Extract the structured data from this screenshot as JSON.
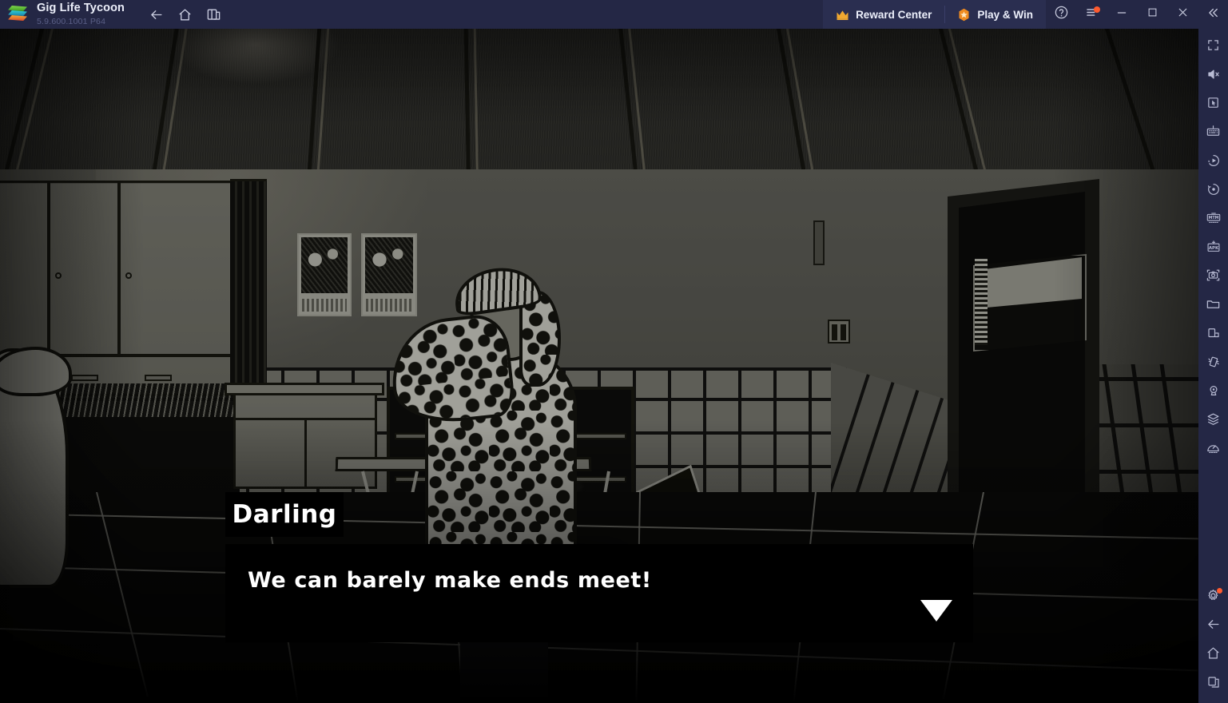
{
  "titlebar": {
    "logo_icon": "bluestacks-logo",
    "app_title": "Gig Life Tycoon",
    "app_version": "5.9.600.1001 P64",
    "nav": [
      {
        "name": "back",
        "icon": "arrow-left-icon"
      },
      {
        "name": "home",
        "icon": "home-icon"
      },
      {
        "name": "multi-instance",
        "icon": "windows-stack-icon"
      }
    ],
    "promos": [
      {
        "name": "reward-center",
        "label": "Reward Center",
        "icon": "crown-icon",
        "icon_color": "#f0a830"
      },
      {
        "name": "play-and-win",
        "label": "Play & Win",
        "icon": "star-badge-icon",
        "icon_color": "#f08c20"
      }
    ],
    "controls": [
      {
        "name": "help",
        "icon": "question-circle-icon",
        "badge": false
      },
      {
        "name": "menu",
        "icon": "hamburger-menu-icon",
        "badge": true
      },
      {
        "name": "minimize",
        "icon": "minimize-icon",
        "badge": false
      },
      {
        "name": "maximize",
        "icon": "maximize-icon",
        "badge": false
      },
      {
        "name": "close",
        "icon": "close-icon",
        "badge": false
      },
      {
        "name": "collapse",
        "icon": "double-chevron-left-icon",
        "badge": false
      }
    ],
    "bar_color": "#242745",
    "accent_color": "#ff5a2e"
  },
  "sidebar": {
    "top_items": [
      {
        "name": "fullscreen",
        "icon": "fullscreen-icon"
      },
      {
        "name": "mute",
        "icon": "speaker-mute-icon"
      },
      {
        "name": "game-controls",
        "icon": "cursor-in-box-icon"
      },
      {
        "name": "keyboard-controls",
        "icon": "keyboard-icon"
      },
      {
        "name": "macro-recorder",
        "icon": "play-circle-icon"
      },
      {
        "name": "script-record",
        "icon": "record-dot-icon"
      },
      {
        "name": "multi-instance-sync",
        "icon": "mtm-sync-icon"
      },
      {
        "name": "install-apk",
        "icon": "apk-plus-icon"
      },
      {
        "name": "screenshot",
        "icon": "camera-icon"
      },
      {
        "name": "media-manager",
        "icon": "folder-icon"
      },
      {
        "name": "pip-mode",
        "icon": "pip-window-icon"
      },
      {
        "name": "shake",
        "icon": "shake-device-icon"
      },
      {
        "name": "location",
        "icon": "location-pin-icon"
      },
      {
        "name": "instance-manager",
        "icon": "layers-icon"
      },
      {
        "name": "performance",
        "icon": "gauge-icon"
      }
    ],
    "bottom_items": [
      {
        "name": "settings",
        "icon": "gear-icon",
        "badge": true
      },
      {
        "name": "back",
        "icon": "arrow-left-icon",
        "badge": false
      },
      {
        "name": "home",
        "icon": "home-icon",
        "badge": false
      },
      {
        "name": "recent-apps",
        "icon": "recents-icon",
        "badge": false
      }
    ],
    "bar_color": "#242745"
  },
  "game": {
    "title": "Gig Life Tycoon",
    "dialogue": {
      "speaker": "Darling",
      "line": "We can barely make ends meet!",
      "advance_indicator": "down-triangle-icon",
      "box_color": "#000000",
      "text_color": "#ffffff"
    },
    "scene": {
      "setting": "kitchen-interior",
      "palette": {
        "wall": "#6f6f66",
        "tile": "#8a8a80",
        "outline": "#15150f",
        "floor": "#0b0b09",
        "ceiling": "#33332e"
      },
      "props": [
        {
          "name": "ceiling-light",
          "type": "light-fixture"
        },
        {
          "name": "wall-cabinets",
          "type": "cabinet"
        },
        {
          "name": "counter",
          "type": "counter"
        },
        {
          "name": "kitchen-table",
          "type": "table"
        },
        {
          "name": "chair",
          "type": "chair"
        },
        {
          "name": "wall-poster-left",
          "type": "poster"
        },
        {
          "name": "wall-poster-right",
          "type": "poster"
        },
        {
          "name": "doorway",
          "type": "door"
        },
        {
          "name": "light-switch",
          "type": "switch"
        }
      ],
      "characters": [
        {
          "name": "darling",
          "description": "woman in spotted dress with hand raised to head"
        },
        {
          "name": "bystander-left",
          "description": "partial figure at left edge"
        }
      ]
    }
  }
}
